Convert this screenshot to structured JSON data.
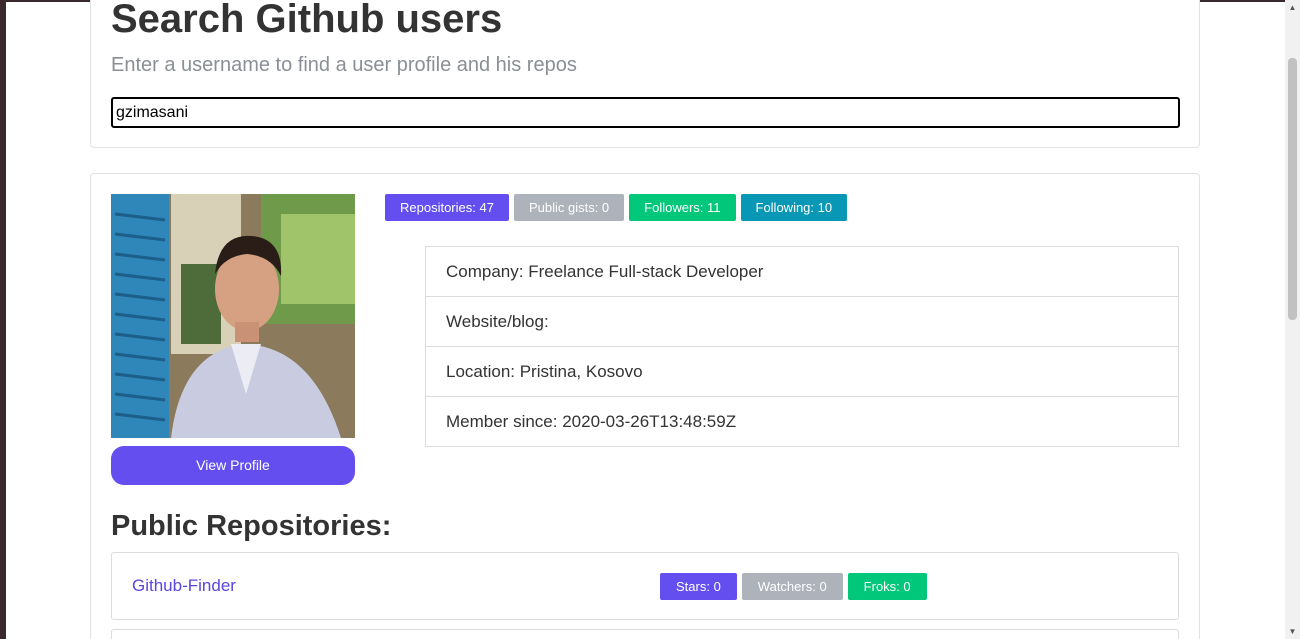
{
  "search": {
    "title": "Search Github users",
    "subtitle": "Enter a username to find a user profile and his repos",
    "value": "gzimasani"
  },
  "profile": {
    "view_profile_label": "View Profile",
    "badges": {
      "repositories": "Repositories: 47",
      "public_gists": "Public gists: 0",
      "followers": "Followers: 11",
      "following": "Following: 10"
    },
    "info": {
      "company": "Company: Freelance Full-stack Developer",
      "website": "Website/blog:",
      "location": "Location: Pristina, Kosovo",
      "member_since": "Member since: 2020-03-26T13:48:59Z"
    }
  },
  "repos": {
    "title": "Public Repositories:",
    "items": [
      {
        "name": "Github-Finder",
        "stars": "Stars: 0",
        "watchers": "Watchers: 0",
        "forks": "Froks: 0"
      }
    ]
  },
  "colors": {
    "accent": "#654ef0",
    "gray_badge": "#aeb2bb",
    "green_badge": "#00c77a",
    "teal_badge": "#0997b6"
  }
}
